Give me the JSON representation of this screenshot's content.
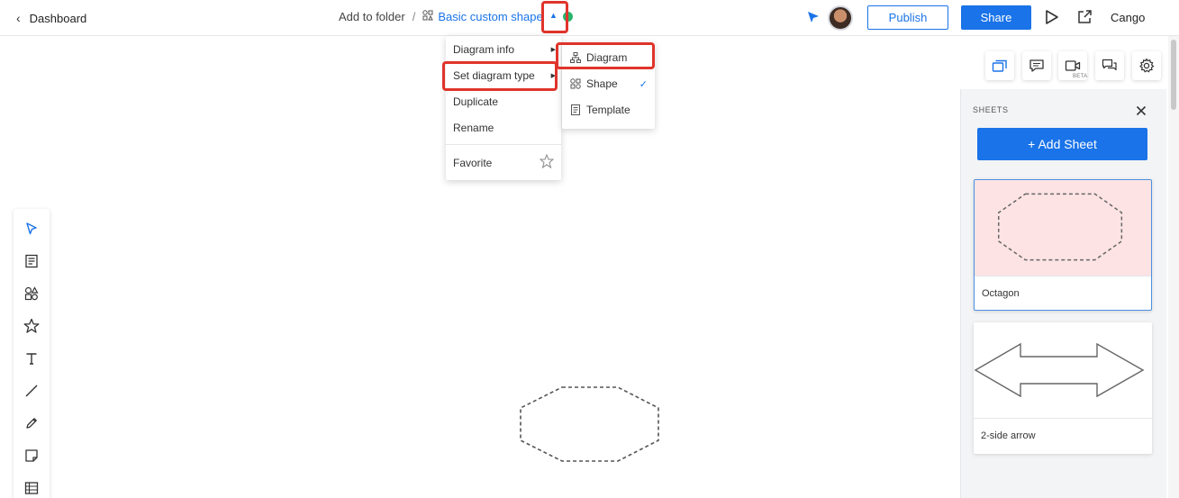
{
  "topbar": {
    "back_label": "Dashboard",
    "folder_link": "Add to folder",
    "separator": "/",
    "doc_title": "Basic custom shape",
    "publish_label": "Publish",
    "share_label": "Share",
    "user_name": "Cango"
  },
  "doc_menu": {
    "items": [
      {
        "label": "Diagram info"
      },
      {
        "label": "Set diagram type"
      },
      {
        "label": "Duplicate"
      },
      {
        "label": "Rename"
      },
      {
        "label": "Favorite"
      }
    ]
  },
  "type_submenu": {
    "items": [
      {
        "label": "Diagram"
      },
      {
        "label": "Shape",
        "checked": true
      },
      {
        "label": "Template"
      }
    ]
  },
  "right_toolbar": {
    "beta_badge": "BETA"
  },
  "sheets_panel": {
    "title": "SHEETS",
    "add_label": "+ Add Sheet",
    "sheets": [
      {
        "name": "Octagon",
        "active": true
      },
      {
        "name": "2-side arrow",
        "active": false
      }
    ]
  },
  "colors": {
    "accent": "#1a73e8",
    "highlight": "#e0342b",
    "active_sheet_bg": "#fde3e4",
    "sync_ok": "#29b36b"
  }
}
